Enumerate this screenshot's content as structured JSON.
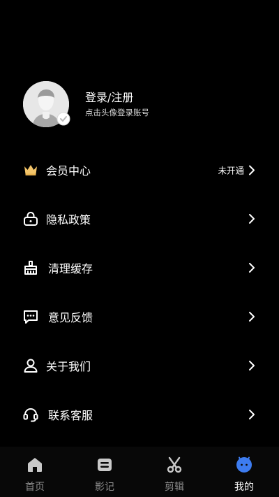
{
  "profile": {
    "title": "登录/注册",
    "subtitle": "点击头像登录账号",
    "avatar_icon": "default-avatar-icon",
    "badge_icon": "edit-badge-icon"
  },
  "menu": [
    {
      "label": "会员中心",
      "icon": "crown-icon",
      "status": "未开通",
      "chevron": "chevron-right-icon"
    },
    {
      "label": "隐私政策",
      "icon": "lock-icon",
      "chevron": "chevron-right-icon"
    },
    {
      "label": "清理缓存",
      "icon": "broom-icon",
      "chevron": "chevron-right-icon"
    },
    {
      "label": "意见反馈",
      "icon": "chat-bubble-icon",
      "chevron": "chevron-right-icon"
    },
    {
      "label": "关于我们",
      "icon": "person-icon",
      "chevron": "chevron-right-icon"
    },
    {
      "label": "联系客服",
      "icon": "headset-icon",
      "chevron": "chevron-right-icon"
    }
  ],
  "tabbar": {
    "items": [
      {
        "label": "首页",
        "icon": "home-icon",
        "active": false
      },
      {
        "label": "影记",
        "icon": "film-record-icon",
        "active": false
      },
      {
        "label": "剪辑",
        "icon": "scissors-icon",
        "active": false
      },
      {
        "label": "我的",
        "icon": "profile-blue-icon",
        "active": true
      }
    ]
  },
  "colors": {
    "background": "#000000",
    "tabbar_background": "#080808",
    "text_primary": "#ffffff",
    "text_secondary": "#8e8e8e",
    "crown_gold": "#f4c56a",
    "active_blue": "#3d7cf0"
  }
}
